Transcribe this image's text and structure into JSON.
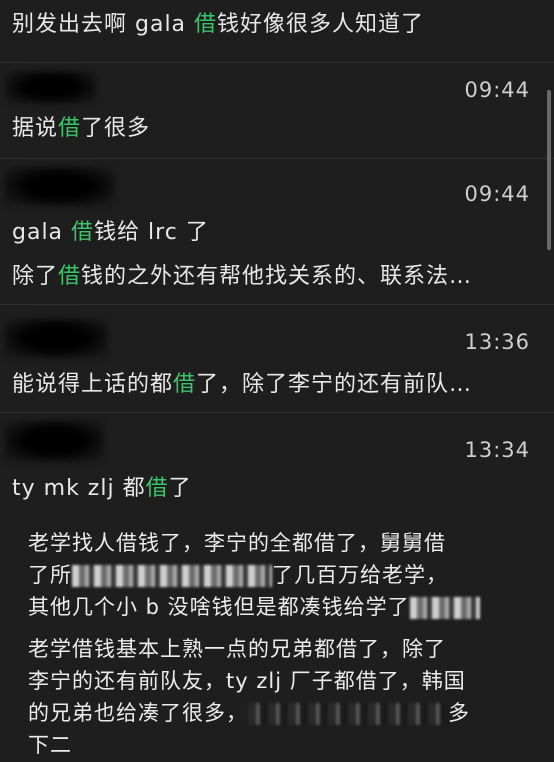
{
  "messages": [
    {
      "pre": "别发出去啊 gala ",
      "hl": "借",
      "post": "钱好像很多人知道了"
    },
    {
      "time": "09:44",
      "pre": "据说",
      "hl": "借",
      "post": "了很多"
    },
    {
      "time": "09:44",
      "pre": "gala ",
      "hl": "借",
      "post": "钱给 lrc 了"
    },
    {
      "pre": "除了",
      "hl": "借",
      "post": "钱的之外还有帮他找关系的、联系法…"
    },
    {
      "time": "13:36",
      "pre": "能说得上话的都",
      "hl": "借",
      "post": "了，除了李宁的还有前队…"
    },
    {
      "time": "13:34",
      "pre": "ty mk zlj 都",
      "hl": "借",
      "post": "了"
    }
  ],
  "quote": {
    "line1": "老学找人借钱了，李宁的全都借了，舅舅借",
    "line2_pre": "了所",
    "line2_post": "了几百万给老学，",
    "line3_pre": "其他几个小 b 没啥钱但是都凑钱给学了",
    "line4": "老学借钱基本上熟一点的兄弟都借了，除了",
    "line5": "李宁的还有前队友，ty zlj 厂子都借了，韩国",
    "line6_pre": "的兄弟也给凑了很多，",
    "line6_post": "多",
    "line7": "下二"
  }
}
